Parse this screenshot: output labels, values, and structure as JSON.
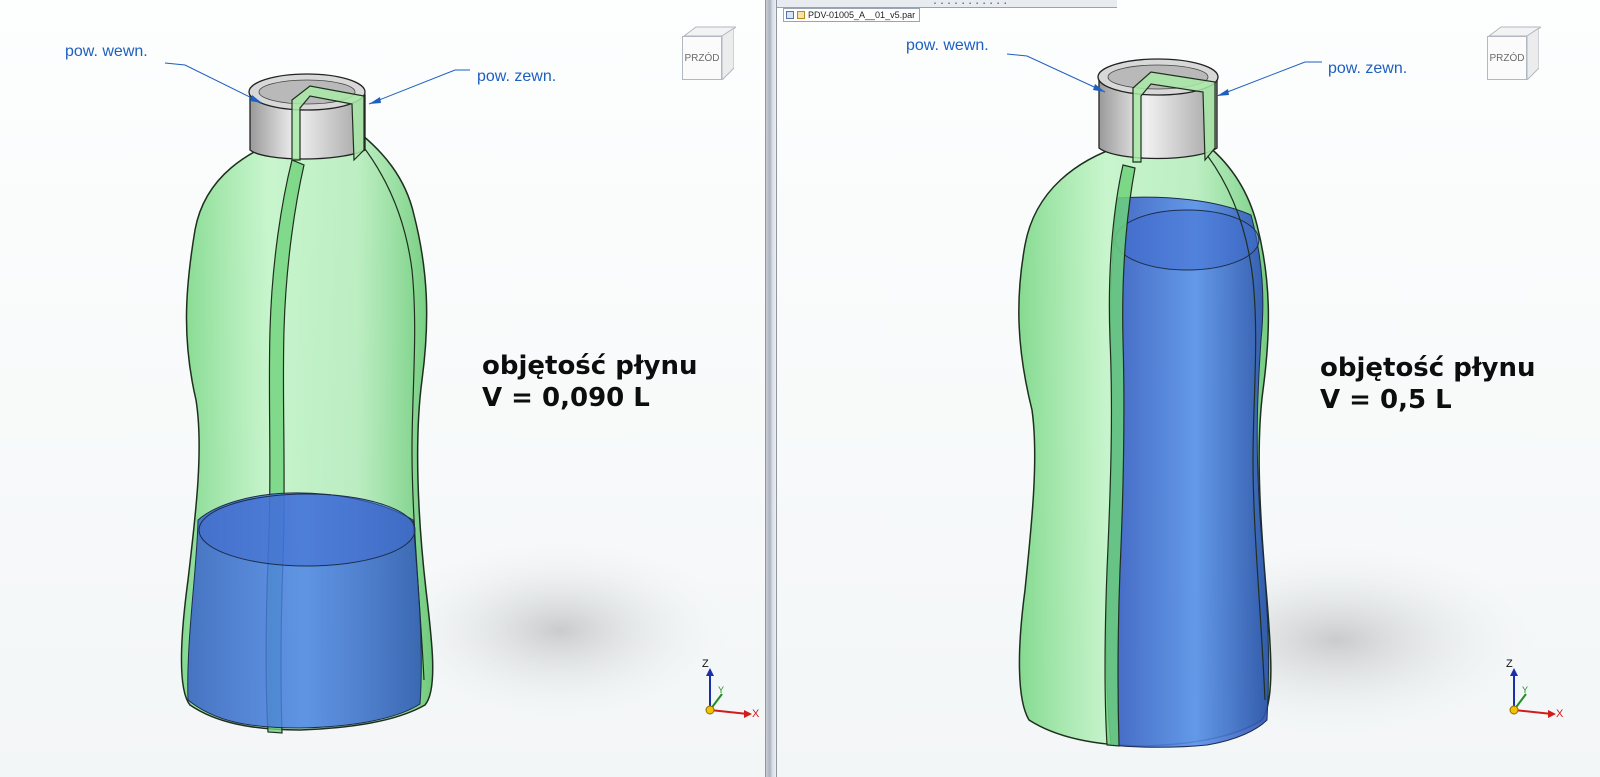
{
  "left": {
    "label_inner": "pow. wewn.",
    "label_outer": "pow. zewn.",
    "volume_title": "objętość płynu",
    "volume_value": "V = 0,090 L",
    "liquid_fill_fraction": 0.18
  },
  "right": {
    "tab_title": "PDV-01005_A__01_v5.par",
    "tab_dots": "...........",
    "label_inner": "pow. wewn.",
    "label_outer": "pow. zewn.",
    "volume_title": "objętość płynu",
    "volume_value": "V = 0,5 L",
    "liquid_fill_fraction": 1.0
  },
  "viewcube": {
    "face_label": "PRZÓD"
  },
  "triad": {
    "z": "Z",
    "y": "Y",
    "x": "X"
  },
  "colors": {
    "bottle_green": "#7fe08a",
    "liquid_blue": "#3a6fd9",
    "label_blue": "#1e5fbf",
    "cap_gray": "#c9c9c9"
  }
}
